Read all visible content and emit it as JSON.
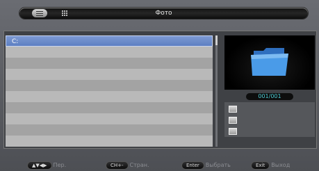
{
  "header": {
    "title": "Фото",
    "tabs": [
      {
        "name": "list-view",
        "icon": "list-icon",
        "active": true
      },
      {
        "name": "grid-view",
        "icon": "grid-icon",
        "active": false
      }
    ]
  },
  "file_list": {
    "rows": [
      {
        "label": "C:",
        "selected": true
      },
      {
        "label": ""
      },
      {
        "label": ""
      },
      {
        "label": ""
      },
      {
        "label": ""
      },
      {
        "label": ""
      },
      {
        "label": ""
      },
      {
        "label": ""
      },
      {
        "label": ""
      },
      {
        "label": ""
      }
    ]
  },
  "preview": {
    "icon": "folder-icon",
    "counter": "001/001"
  },
  "info_icons": [
    "file-info-icon",
    "date-icon",
    "size-icon"
  ],
  "help_bar": {
    "items": [
      {
        "key": "▲▼◀▶",
        "label": "Пер."
      },
      {
        "key": "CH+-",
        "label": "Стран."
      },
      {
        "key": "Enter",
        "label": "Выбрать"
      },
      {
        "key": "Exit",
        "label": "Выход"
      }
    ]
  },
  "colors": {
    "selection": "#6b8cc9",
    "counter_text": "#4fd0d8",
    "folder": "#3f8fe0"
  }
}
